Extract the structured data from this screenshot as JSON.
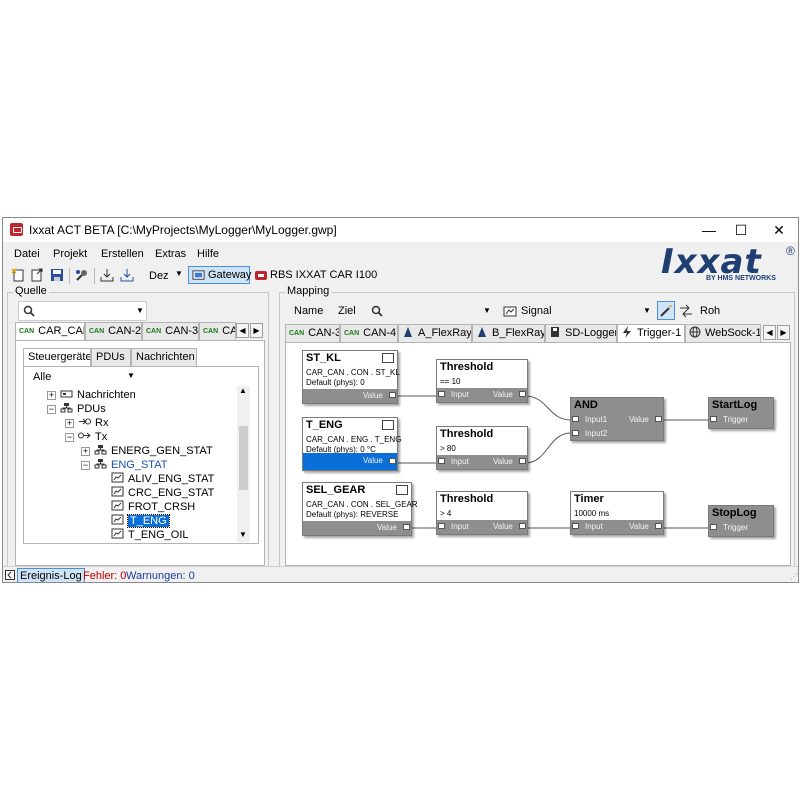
{
  "window": {
    "title": "Ixxat ACT BETA [C:\\MyProjects\\MyLogger\\MyLogger.gwp]",
    "controls": {
      "minimize": "—",
      "maximize": "☐",
      "close": "✕"
    }
  },
  "menu": [
    "Datei",
    "Projekt",
    "Erstellen",
    "Extras",
    "Hilfe"
  ],
  "toolbar": {
    "format_select": "Dez",
    "gateway_label": "Gateway",
    "device_label": "RBS IXXAT CAR I100"
  },
  "logo": {
    "brand": "Ixxat",
    "registered": "®",
    "tagline": "BY HMS NETWORKS",
    "color": "#1f3f72"
  },
  "quelle": {
    "label": "Quelle",
    "tabs": [
      "CAR_CAN",
      "CAN-2",
      "CAN-3",
      "CAN"
    ],
    "subtabs": [
      "Steuergeräte",
      "PDUs",
      "Nachrichten"
    ],
    "filter": "Alle",
    "tree": [
      {
        "label": "Nachrichten",
        "expander": "+"
      },
      {
        "label": "PDUs",
        "expander": "−"
      },
      {
        "label": "Rx",
        "expander": "+"
      },
      {
        "label": "Tx",
        "expander": "−"
      },
      {
        "label": "ENERG_GEN_STAT",
        "expander": "+"
      },
      {
        "label": "ENG_STAT",
        "expander": "−"
      },
      {
        "label": "ALIV_ENG_STAT"
      },
      {
        "label": "CRC_ENG_STAT"
      },
      {
        "label": "FROT_CRSH"
      },
      {
        "label": "T_ENG",
        "selected": true
      },
      {
        "label": "T_ENG_OIL"
      }
    ]
  },
  "mapping": {
    "label": "Mapping",
    "toolbar": {
      "name": "Name",
      "ziel": "Ziel",
      "signal": "Signal",
      "roh": "Roh"
    },
    "tabs": [
      {
        "label": "CAN-3",
        "icon": "can"
      },
      {
        "label": "CAN-4",
        "icon": "can"
      },
      {
        "label": "A_FlexRay",
        "icon": "flexray"
      },
      {
        "label": "B_FlexRay",
        "icon": "flexray"
      },
      {
        "label": "SD-Logger",
        "icon": "disk"
      },
      {
        "label": "Trigger-1",
        "icon": "bolt",
        "active": true
      },
      {
        "label": "WebSock-1",
        "icon": "globe"
      }
    ],
    "nodes": {
      "st_kl": {
        "title": "ST_KL",
        "line1": "CAR_CAN . CON . ST_KL",
        "line2": "Default (phys): 0",
        "out": "Value"
      },
      "t_eng": {
        "title": "T_ENG",
        "line1": "CAR_CAN . ENG . T_ENG",
        "line2": "Default (phys): 0 °C",
        "out": "Value"
      },
      "sel_gear": {
        "title": "SEL_GEAR",
        "line1": "CAR_CAN . CON . SEL_GEAR",
        "line2": "Default (phys): REVERSE",
        "out": "Value"
      },
      "thr1": {
        "title": "Threshold",
        "line1": "== 10",
        "in": "Input",
        "out": "Value"
      },
      "thr2": {
        "title": "Threshold",
        "line1": "> 80",
        "in": "Input",
        "out": "Value"
      },
      "thr3": {
        "title": "Threshold",
        "line1": "> 4",
        "in": "Input",
        "out": "Value"
      },
      "and": {
        "title": "AND",
        "in1": "Input1",
        "in2": "Input2",
        "out": "Value"
      },
      "timer": {
        "title": "Timer",
        "line1": "10000 ms",
        "in": "Input",
        "out": "Value"
      },
      "startlog": {
        "title": "StartLog",
        "in": "Trigger"
      },
      "stoplog": {
        "title": "StopLog",
        "in": "Trigger"
      }
    }
  },
  "status": {
    "log_tab": "Ereignis-Log",
    "errors": "Fehler: 0",
    "warnings": "Warnungen: 0",
    "error_color": "#c00000",
    "warning_color": "#1a3ea0"
  },
  "colors": {
    "selection": "#0a6fd8",
    "node_footer": "#8e8e8e"
  }
}
